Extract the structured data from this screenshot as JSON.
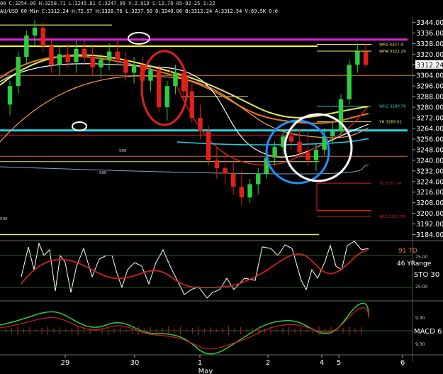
{
  "header": {
    "line1": "00 C:3254.09 H:3258.71 L:3245.81 C:3247.99 V:2.919 S:12.70 05-02-25 1:22",
    "line2": "AU/USD 60-Min C:3312.24 H:72.97 H:3328.76 L:3237.50 O:3240.06 B:3312.24 A:3312.54 V:69.5K O:0"
  },
  "colors": {
    "background": "#000000",
    "bull": "#2ecc40",
    "bear": "#e0201a",
    "magenta": "#e020e0",
    "cyan": "#22d3e0",
    "yellow": "#f0f060",
    "orange": "#e07a20",
    "white": "#ffffff",
    "red_ellipse": "#e02020",
    "blue_circle": "#1e90ff"
  },
  "chart_data": [
    {
      "type": "candlestick",
      "title": "",
      "ylim": [
        3180,
        3348
      ],
      "y_ticks": [
        "3344.00",
        "3336.00",
        "3328.00",
        "3320.00",
        "3312.24",
        "3304.00",
        "3296.00",
        "3288.00",
        "3280.00",
        "3272.00",
        "3264.00",
        "3256.00",
        "3248.00",
        "3240.00",
        "3232.00",
        "3224.00",
        "3216.00",
        "3208.00",
        "3200.00",
        "3192.00",
        "3184.00"
      ],
      "last_price": "3312.24",
      "candles": [
        {
          "o": 3282,
          "h": 3300,
          "l": 3274,
          "c": 3296
        },
        {
          "o": 3296,
          "h": 3322,
          "l": 3290,
          "c": 3318
        },
        {
          "o": 3318,
          "h": 3338,
          "l": 3312,
          "c": 3334
        },
        {
          "o": 3334,
          "h": 3346,
          "l": 3326,
          "c": 3340
        },
        {
          "o": 3340,
          "h": 3344,
          "l": 3322,
          "c": 3326
        },
        {
          "o": 3326,
          "h": 3332,
          "l": 3306,
          "c": 3312
        },
        {
          "o": 3312,
          "h": 3326,
          "l": 3304,
          "c": 3320
        },
        {
          "o": 3320,
          "h": 3328,
          "l": 3310,
          "c": 3314
        },
        {
          "o": 3314,
          "h": 3330,
          "l": 3306,
          "c": 3324
        },
        {
          "o": 3324,
          "h": 3332,
          "l": 3312,
          "c": 3318
        },
        {
          "o": 3318,
          "h": 3326,
          "l": 3304,
          "c": 3310
        },
        {
          "o": 3310,
          "h": 3320,
          "l": 3302,
          "c": 3316
        },
        {
          "o": 3316,
          "h": 3328,
          "l": 3308,
          "c": 3322
        },
        {
          "o": 3322,
          "h": 3330,
          "l": 3312,
          "c": 3316
        },
        {
          "o": 3316,
          "h": 3322,
          "l": 3300,
          "c": 3306
        },
        {
          "o": 3306,
          "h": 3318,
          "l": 3298,
          "c": 3312
        },
        {
          "o": 3312,
          "h": 3318,
          "l": 3296,
          "c": 3300
        },
        {
          "o": 3300,
          "h": 3312,
          "l": 3292,
          "c": 3308
        },
        {
          "o": 3308,
          "h": 3312,
          "l": 3276,
          "c": 3280
        },
        {
          "o": 3280,
          "h": 3300,
          "l": 3270,
          "c": 3296
        },
        {
          "o": 3296,
          "h": 3312,
          "l": 3290,
          "c": 3306
        },
        {
          "o": 3306,
          "h": 3310,
          "l": 3286,
          "c": 3292
        },
        {
          "o": 3292,
          "h": 3298,
          "l": 3268,
          "c": 3272
        },
        {
          "o": 3272,
          "h": 3282,
          "l": 3256,
          "c": 3262
        },
        {
          "o": 3262,
          "h": 3266,
          "l": 3236,
          "c": 3240
        },
        {
          "o": 3240,
          "h": 3250,
          "l": 3226,
          "c": 3234
        },
        {
          "o": 3234,
          "h": 3246,
          "l": 3222,
          "c": 3230
        },
        {
          "o": 3230,
          "h": 3240,
          "l": 3214,
          "c": 3220
        },
        {
          "o": 3220,
          "h": 3232,
          "l": 3206,
          "c": 3212
        },
        {
          "o": 3212,
          "h": 3226,
          "l": 3208,
          "c": 3222
        },
        {
          "o": 3222,
          "h": 3234,
          "l": 3214,
          "c": 3230
        },
        {
          "o": 3230,
          "h": 3246,
          "l": 3226,
          "c": 3242
        },
        {
          "o": 3242,
          "h": 3254,
          "l": 3236,
          "c": 3250
        },
        {
          "o": 3250,
          "h": 3262,
          "l": 3244,
          "c": 3258
        },
        {
          "o": 3258,
          "h": 3266,
          "l": 3248,
          "c": 3254
        },
        {
          "o": 3254,
          "h": 3264,
          "l": 3242,
          "c": 3246
        },
        {
          "o": 3246,
          "h": 3262,
          "l": 3236,
          "c": 3240
        },
        {
          "o": 3240,
          "h": 3252,
          "l": 3232,
          "c": 3248
        },
        {
          "o": 3248,
          "h": 3264,
          "l": 3244,
          "c": 3258
        },
        {
          "o": 3258,
          "h": 3270,
          "l": 3252,
          "c": 3262
        },
        {
          "o": 3262,
          "h": 3290,
          "l": 3258,
          "c": 3286
        },
        {
          "o": 3286,
          "h": 3316,
          "l": 3282,
          "c": 3312
        },
        {
          "o": 3312,
          "h": 3328,
          "l": 3306,
          "c": 3322
        },
        {
          "o": 3322,
          "h": 3328,
          "l": 3310,
          "c": 3312
        }
      ],
      "levels": [
        {
          "name": "WR1",
          "label": "WR1 3327.4",
          "value": 3327.4,
          "color": "#f0f060"
        },
        {
          "name": "WH4",
          "label": "WH4 3322.29",
          "value": 3322.29,
          "color": "#f0f060"
        },
        {
          "name": "WH3",
          "label": "WH3 3280.78",
          "value": 3280.78,
          "color": "#22d3e0"
        },
        {
          "name": "YH",
          "label": "YH 3269.01",
          "value": 3269.01,
          "color": "#f0f060"
        },
        {
          "name": "YL",
          "label": "YL 3222.74",
          "value": 3222.74,
          "color": "#e0201a"
        },
        {
          "name": "WL3",
          "label": "WL3 3197.76",
          "value": 3197.76,
          "color": "#e0201a"
        }
      ],
      "small_labels": [
        "500",
        "500",
        "500"
      ],
      "x_labels": [
        "29",
        "30",
        "1",
        "2",
        "4",
        "5",
        "6"
      ],
      "x_sublabel": "May"
    },
    {
      "type": "line",
      "title": "STO",
      "labels": [
        "91 TD",
        "46 YRange",
        "STO 30"
      ],
      "ticks": [
        "75.00",
        "25.00"
      ]
    },
    {
      "type": "line",
      "title": "MACD",
      "labels": [
        "MACD 6"
      ],
      "ticks": [
        "9.30",
        "9.30"
      ]
    }
  ]
}
